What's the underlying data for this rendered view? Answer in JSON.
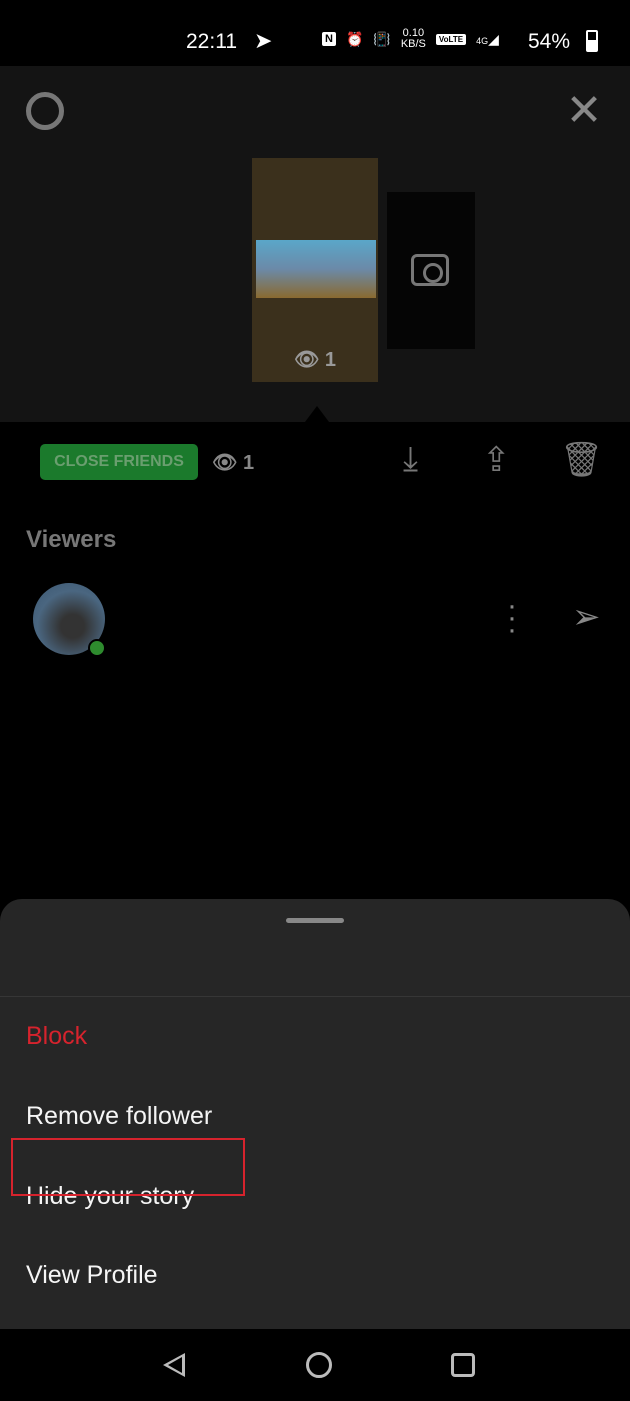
{
  "status_bar": {
    "time": "22:11",
    "net_speed": "0.10",
    "net_unit": "KB/S",
    "volte": "VoLTE",
    "network": "4G",
    "battery": "54%"
  },
  "story": {
    "views": "1"
  },
  "toolbar": {
    "audience_badge": "CLOSE FRIENDS",
    "view_count": "1",
    "badge_color": "#1b7a2c"
  },
  "viewers": {
    "heading": "Viewers"
  },
  "sheet": {
    "options": [
      {
        "label": "Block",
        "color": "#d6232d"
      },
      {
        "label": "Remove follower"
      },
      {
        "label": "Hide your story",
        "highlighted": true
      },
      {
        "label": "View Profile"
      }
    ]
  }
}
